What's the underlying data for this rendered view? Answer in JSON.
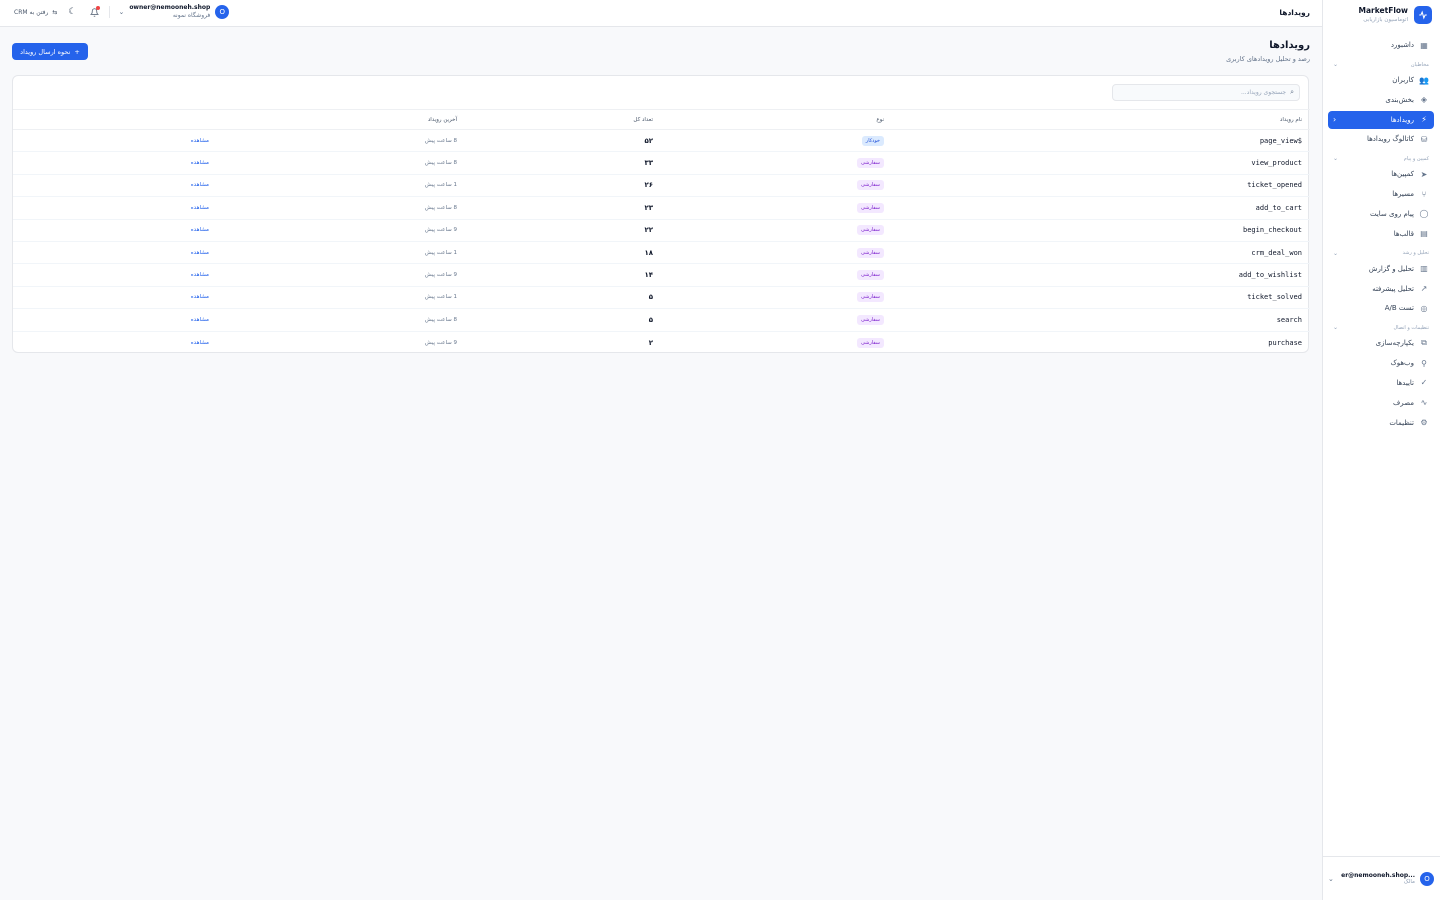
{
  "app": {
    "name": "MarketFlow",
    "subtitle": "اتوماسیون بازاریابی",
    "logo_icon": "activity-icon"
  },
  "sidebar": {
    "items_top": [
      {
        "label": "داشبورد",
        "icon": "grid-icon"
      }
    ],
    "groups": [
      {
        "title": "مخاطبان",
        "items": [
          {
            "label": "کاربران",
            "icon": "users-icon"
          },
          {
            "label": "بخش‌بندی",
            "icon": "layers-icon"
          },
          {
            "label": "رویدادها",
            "icon": "zap-icon",
            "active": true
          },
          {
            "label": "کاتالوگ رویدادها",
            "icon": "database-icon"
          }
        ]
      },
      {
        "title": "کمپین و پیام",
        "items": [
          {
            "label": "کمپین‌ها",
            "icon": "send-icon"
          },
          {
            "label": "مسیرها",
            "icon": "git-branch-icon"
          },
          {
            "label": "پیام روی سایت",
            "icon": "message-icon"
          },
          {
            "label": "قالب‌ها",
            "icon": "file-icon"
          }
        ]
      },
      {
        "title": "تحلیل و رشد",
        "items": [
          {
            "label": "تحلیل و گزارش",
            "icon": "bar-chart-icon"
          },
          {
            "label": "تحلیل پیشرفته",
            "icon": "trending-icon"
          },
          {
            "label": "تست A/B",
            "icon": "target-icon"
          }
        ]
      },
      {
        "title": "تنظیمات و اتصال",
        "items": [
          {
            "label": "یکپارچه‌سازی",
            "icon": "puzzle-icon"
          },
          {
            "label": "وب‌هوک",
            "icon": "webhook-icon"
          },
          {
            "label": "تاییدها",
            "icon": "check-circle-icon"
          },
          {
            "label": "مصرف",
            "icon": "pulse-icon"
          },
          {
            "label": "تنظیمات",
            "icon": "gear-icon"
          }
        ]
      }
    ],
    "user": {
      "avatar": "O",
      "email": "...er@nemooneh.shop",
      "role": "مالک"
    }
  },
  "topbar": {
    "title": "رویدادها",
    "crm_link": "رفتن به CRM",
    "account_email": "owner@nemooneh.shop",
    "account_shop": "فروشگاه نمونه",
    "avatar": "O"
  },
  "page": {
    "title": "رویدادها",
    "subtitle": "رصد و تحلیل رویدادهای کاربری",
    "primary_button": "نحوه ارسال رویداد"
  },
  "search": {
    "placeholder": "جستجوی رویداد..."
  },
  "table": {
    "columns": {
      "name": "نام رویداد",
      "type": "نوع",
      "count": "تعداد کل",
      "last": "آخرین رویداد"
    },
    "rows": [
      {
        "name": "$page_view",
        "type": "خودکار",
        "kind": "auto",
        "count": "۵۲",
        "last": "8 ساعت پیش",
        "action": "مشاهده"
      },
      {
        "name": "view_product",
        "type": "سفارشی",
        "kind": "custom",
        "count": "۳۳",
        "last": "8 ساعت پیش",
        "action": "مشاهده"
      },
      {
        "name": "ticket_opened",
        "type": "سفارشی",
        "kind": "custom",
        "count": "۲۶",
        "last": "1 ساعت پیش",
        "action": "مشاهده"
      },
      {
        "name": "add_to_cart",
        "type": "سفارشی",
        "kind": "custom",
        "count": "۲۳",
        "last": "8 ساعت پیش",
        "action": "مشاهده"
      },
      {
        "name": "begin_checkout",
        "type": "سفارشی",
        "kind": "custom",
        "count": "۲۲",
        "last": "9 ساعت پیش",
        "action": "مشاهده"
      },
      {
        "name": "crm_deal_won",
        "type": "سفارشی",
        "kind": "custom",
        "count": "۱۸",
        "last": "1 ساعت پیش",
        "action": "مشاهده"
      },
      {
        "name": "add_to_wishlist",
        "type": "سفارشی",
        "kind": "custom",
        "count": "۱۴",
        "last": "9 ساعت پیش",
        "action": "مشاهده"
      },
      {
        "name": "ticket_solved",
        "type": "سفارشی",
        "kind": "custom",
        "count": "۵",
        "last": "1 ساعت پیش",
        "action": "مشاهده"
      },
      {
        "name": "search",
        "type": "سفارشی",
        "kind": "custom",
        "count": "۵",
        "last": "8 ساعت پیش",
        "action": "مشاهده"
      },
      {
        "name": "purchase",
        "type": "سفارشی",
        "kind": "custom",
        "count": "۲",
        "last": "9 ساعت پیش",
        "action": "مشاهده"
      }
    ]
  },
  "colors": {
    "accent": "#2563eb",
    "auto_badge": "#1d4ed8",
    "custom_badge": "#7e22ce",
    "notification": "#ef4444"
  }
}
